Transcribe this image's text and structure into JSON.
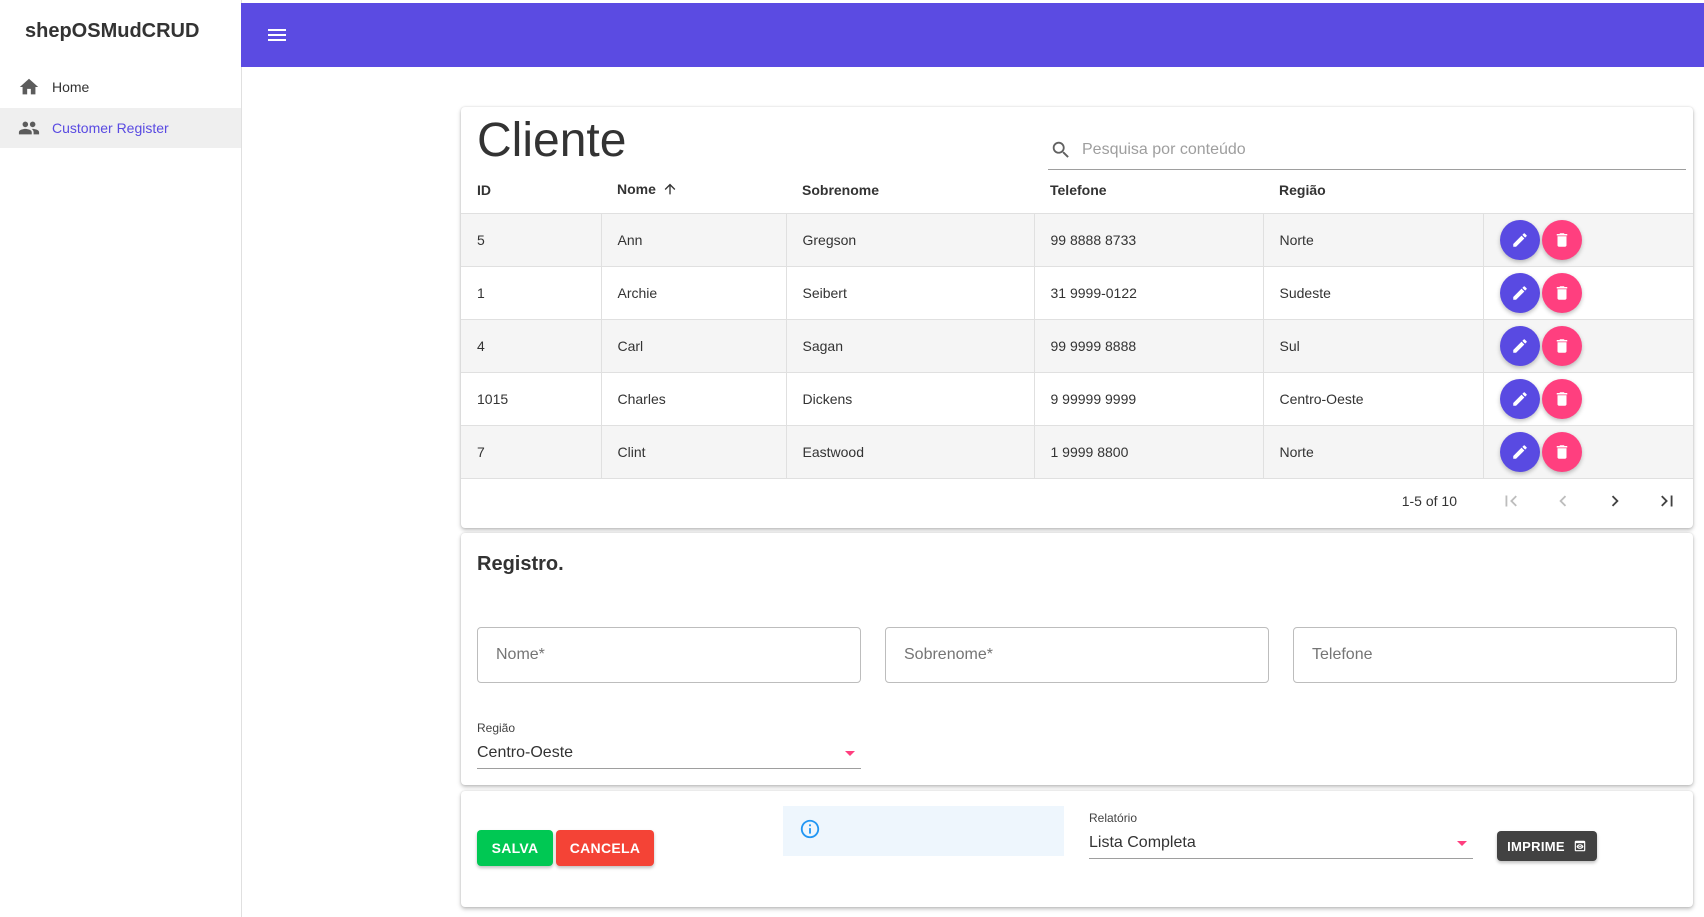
{
  "app": {
    "title": "shepOSMudCRUD"
  },
  "sidebar": {
    "items": [
      {
        "label": "Home",
        "icon": "home-icon"
      },
      {
        "label": "Customer Register",
        "icon": "people-icon"
      }
    ]
  },
  "colors": {
    "primary": "#5b4be2",
    "secondary": "#ff3f7f",
    "success": "#00c853",
    "error": "#f44336",
    "dark": "#424242"
  },
  "table": {
    "title": "Cliente",
    "search_placeholder": "Pesquisa por conteúdo",
    "columns": [
      "ID",
      "Nome",
      "Sobrenome",
      "Telefone",
      "Região"
    ],
    "sorted_column": "Nome",
    "rows": [
      {
        "id": "5",
        "nome": "Ann",
        "sobrenome": "Gregson",
        "telefone": "99 8888 8733",
        "regiao": "Norte"
      },
      {
        "id": "1",
        "nome": "Archie",
        "sobrenome": "Seibert",
        "telefone": "31 9999-0122",
        "regiao": "Sudeste"
      },
      {
        "id": "4",
        "nome": "Carl",
        "sobrenome": "Sagan",
        "telefone": "99 9999 8888",
        "regiao": "Sul"
      },
      {
        "id": "1015",
        "nome": "Charles",
        "sobrenome": "Dickens",
        "telefone": "9 99999 9999",
        "regiao": "Centro-Oeste"
      },
      {
        "id": "7",
        "nome": "Clint",
        "sobrenome": "Eastwood",
        "telefone": "1 9999 8800",
        "regiao": "Norte"
      }
    ],
    "pagination": {
      "info": "1-5 of 10"
    }
  },
  "form": {
    "title": "Registro.",
    "nome_placeholder": "Nome*",
    "sobrenome_placeholder": "Sobrenome*",
    "telefone_placeholder": "Telefone",
    "regiao_label": "Região",
    "regiao_value": "Centro-Oeste"
  },
  "actions": {
    "save_label": "SALVA",
    "cancel_label": "CANCELA",
    "report_label": "Relatório",
    "report_value": "Lista Completa",
    "print_label": "IMPRIME"
  }
}
